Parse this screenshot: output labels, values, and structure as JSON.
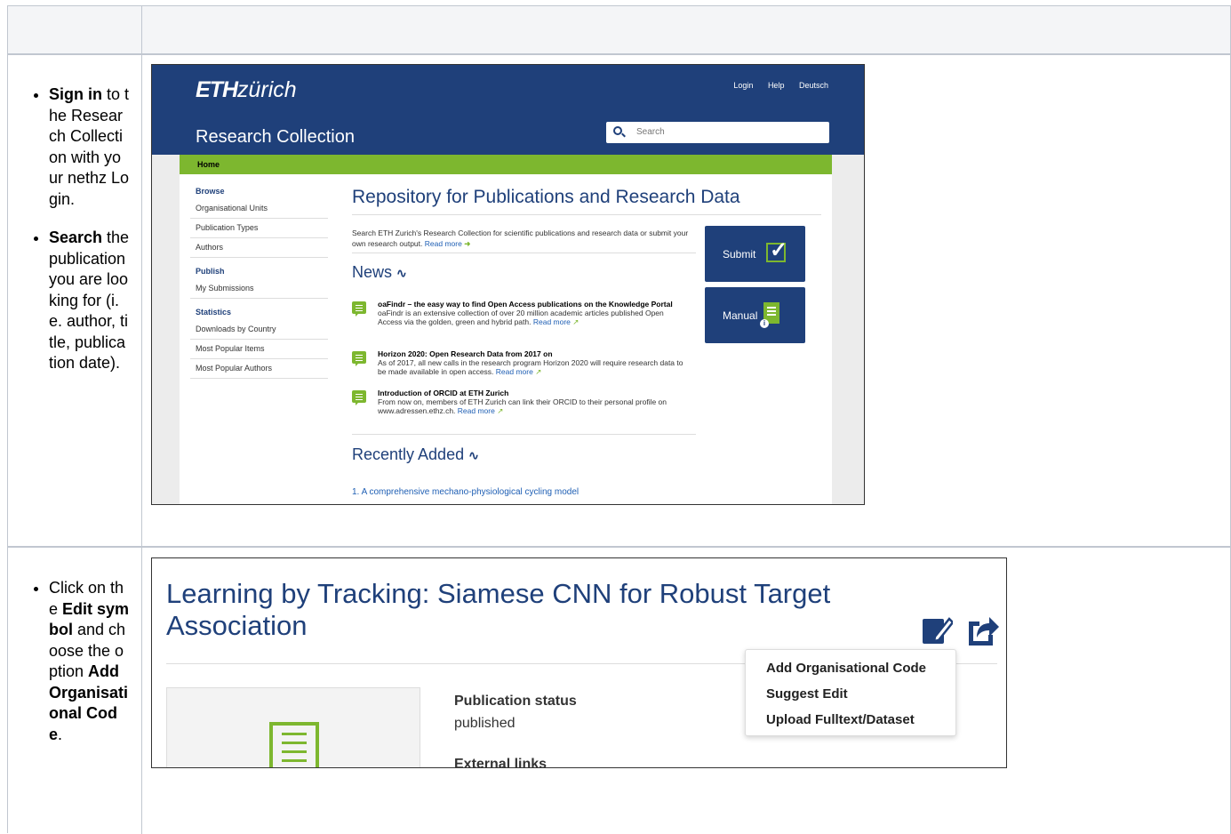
{
  "instructions": {
    "row1": {
      "item1_bold": "Sign in",
      "item1_text": " to the Research Collection with your nethz Login.",
      "item2_bold": "Search",
      "item2_text": " the publication you are looking for (i.e. author, title, publication date)."
    },
    "row2": {
      "item1_pre": "Click on the ",
      "item1_bold1": "Edit symbol",
      "item1_mid": " and choose the option ",
      "item1_bold2": "Add Organisational Code",
      "item1_end": "."
    }
  },
  "eth": {
    "logo_bold": "ETH",
    "logo_rest": "zürich",
    "top_links": [
      "Login",
      "Help",
      "Deutsch"
    ],
    "site_title": "Research Collection",
    "search_placeholder": "Search",
    "breadcrumb": "Home",
    "sidebar": {
      "browse_heading": "Browse",
      "browse_items": [
        "Organisational Units",
        "Publication Types",
        "Authors"
      ],
      "publish_heading": "Publish",
      "publish_items": [
        "My Submissions"
      ],
      "statistics_heading": "Statistics",
      "statistics_items": [
        "Downloads by Country",
        "Most Popular Items",
        "Most Popular Authors"
      ]
    },
    "repo_title": "Repository for Publications and Research Data",
    "intro_text": "Search ETH Zurich's Research Collection for scientific publications and research data or submit your own research output.",
    "read_more": "Read more",
    "news_heading": "News",
    "news": [
      {
        "title": "oaFindr – the easy way to find Open Access publications on the Knowledge Portal",
        "body": "oaFindr is an extensive collection of over 20 million academic articles published Open Access via the golden, green and hybrid path."
      },
      {
        "title": "Horizon 2020: Open Research Data from 2017 on",
        "body": "As of 2017, all new calls in the research program Horizon 2020 will require research data to be made available in open access."
      },
      {
        "title": "Introduction of ORCID at ETH Zurich",
        "body": "From now on, members of ETH Zurich can link their ORCID to their personal profile on www.adressen.ethz.ch."
      }
    ],
    "recent_heading": "Recently Added",
    "recent_item": "1. A comprehensive mechano-physiological cycling model",
    "submit_label": "Submit",
    "manual_label": "Manual"
  },
  "publication": {
    "title": "Learning by Tracking: Siamese CNN for Robust Target Association",
    "status_label": "Publication status",
    "status_value": "published",
    "external_links_label": "External links",
    "menu_items": [
      "Add Organisational Code",
      "Suggest Edit",
      "Upload Fulltext/Dataset"
    ]
  }
}
